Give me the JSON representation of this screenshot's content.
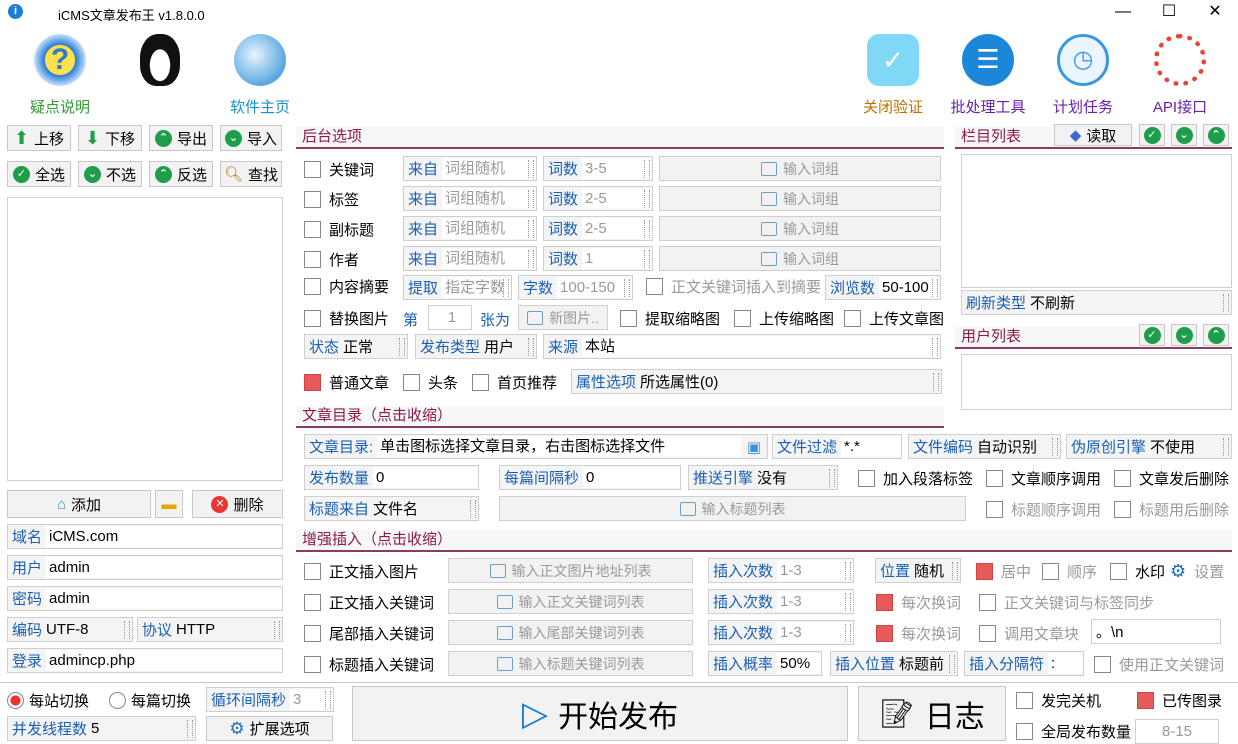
{
  "window": {
    "title": "iCMS文章发布王 v1.8.0.0",
    "min": "—",
    "max": "☐",
    "close": "✕"
  },
  "top_tools": {
    "faq": "疑点说明",
    "home": "软件主页",
    "close_verify": "关闭验证",
    "batch": "批处理工具",
    "schedule": "计划任务",
    "api": "API接口"
  },
  "left_buttons": {
    "up": "上移",
    "down": "下移",
    "export": "导出",
    "import": "导入",
    "select_all": "全选",
    "select_none": "不选",
    "invert": "反选",
    "find": "查找",
    "add": "添加",
    "delete": "删除"
  },
  "site": {
    "domain_k": "域名",
    "domain_v": "iCMS.com",
    "user_k": "用户",
    "user_v": "admin",
    "pass_k": "密码",
    "pass_v": "admin",
    "enc_k": "编码",
    "enc_v": "UTF-8",
    "proto_k": "协议",
    "proto_v": "HTTP",
    "login_k": "登录",
    "login_v": "admincp.php"
  },
  "backend": {
    "title": "后台选项",
    "rows": [
      {
        "name": "关键词",
        "src_k": "来自",
        "src_v": "词组随机",
        "cnt_k": "词数",
        "cnt_v": "3-5",
        "input": "输入词组"
      },
      {
        "name": "标签",
        "src_k": "来自",
        "src_v": "词组随机",
        "cnt_k": "词数",
        "cnt_v": "2-5",
        "input": "输入词组"
      },
      {
        "name": "副标题",
        "src_k": "来自",
        "src_v": "词组随机",
        "cnt_k": "词数",
        "cnt_v": "2-5",
        "input": "输入词组"
      },
      {
        "name": "作者",
        "src_k": "来自",
        "src_v": "词组随机",
        "cnt_k": "词数",
        "cnt_v": "1",
        "input": "输入词组"
      }
    ],
    "summary": "内容摘要",
    "extract_k": "提取",
    "extract_v": "指定字数",
    "chars_k": "字数",
    "chars_v": "100-150",
    "kw_to_summary": "正文关键词插入到摘要",
    "views_k": "浏览数",
    "views_v": "50-100",
    "replace_img": "替换图片",
    "nth": "第",
    "nth_v": "1",
    "sheet": "张为",
    "new_img": "新图片..",
    "thumb_extract": "提取缩略图",
    "thumb_upload": "上传缩略图",
    "upload_img": "上传文章图",
    "status_k": "状态",
    "status_v": "正常",
    "ptype_k": "发布类型",
    "ptype_v": "用户",
    "source_k": "来源",
    "source_v": "本站",
    "normal": "普通文章",
    "headline": "头条",
    "home_rec": "首页推荐",
    "attr_k": "属性选项",
    "attr_v": "所选属性(0)"
  },
  "category": {
    "title": "栏目列表",
    "read": "读取",
    "refresh_k": "刷新类型",
    "refresh_v": "不刷新"
  },
  "users": {
    "title": "用户列表"
  },
  "article_dir": {
    "title": "文章目录（点击收缩）",
    "dir_k": "文章目录:",
    "dir_v": "单击图标选择文章目录，右击图标选择文件",
    "filter_k": "文件过滤",
    "filter_v": "*.*",
    "enc_k": "文件编码",
    "enc_v": "自动识别",
    "orig_k": "伪原创引擎",
    "orig_v": "不使用",
    "count_k": "发布数量",
    "count_v": "0",
    "interval_k": "每篇间隔秒",
    "interval_v": "0",
    "push_k": "推送引擎",
    "push_v": "没有",
    "para_tag": "加入段落标签",
    "order": "文章顺序调用",
    "del_after": "文章发后删除",
    "title_src_k": "标题来自",
    "title_src_v": "文件名",
    "title_list": "输入标题列表",
    "title_order": "标题顺序调用",
    "title_del": "标题用后删除"
  },
  "enhance": {
    "title": "增强插入（点击收缩）",
    "r1": "正文插入图片",
    "r1b": "输入正文图片地址列表",
    "ins_k": "插入次数",
    "ins_v": "1-3",
    "pos_k": "位置",
    "pos_v": "随机",
    "center": "居中",
    "seq": "顺序",
    "watermark": "水印",
    "settings": "设置",
    "r2": "正文插入关键词",
    "r2b": "输入正文关键词列表",
    "each": "每次换词",
    "sync": "正文关键词与标签同步",
    "r3": "尾部插入关键词",
    "r3b": "输入尾部关键词列表",
    "call_block": "调用文章块",
    "block_v": "。\\n",
    "r4": "标题插入关键词",
    "r4b": "输入标题关键词列表",
    "prob_k": "插入概率",
    "prob_v": "50%",
    "ipos_k": "插入位置",
    "ipos_v": "标题前",
    "sep_k": "插入分隔符",
    "sep_v": ":",
    "use_body_kw": "使用正文关键词"
  },
  "bottom": {
    "each_site": "每站切换",
    "each_post": "每篇切换",
    "loop_k": "循环间隔秒",
    "loop_v": "3",
    "threads_k": "并发线程数",
    "threads_v": "5",
    "ext": "扩展选项",
    "start": "开始发布",
    "log": "日志",
    "shutdown": "发完关机",
    "uploaded": "已传图录",
    "global_k": "全局发布数量",
    "global_v": "8-15"
  }
}
